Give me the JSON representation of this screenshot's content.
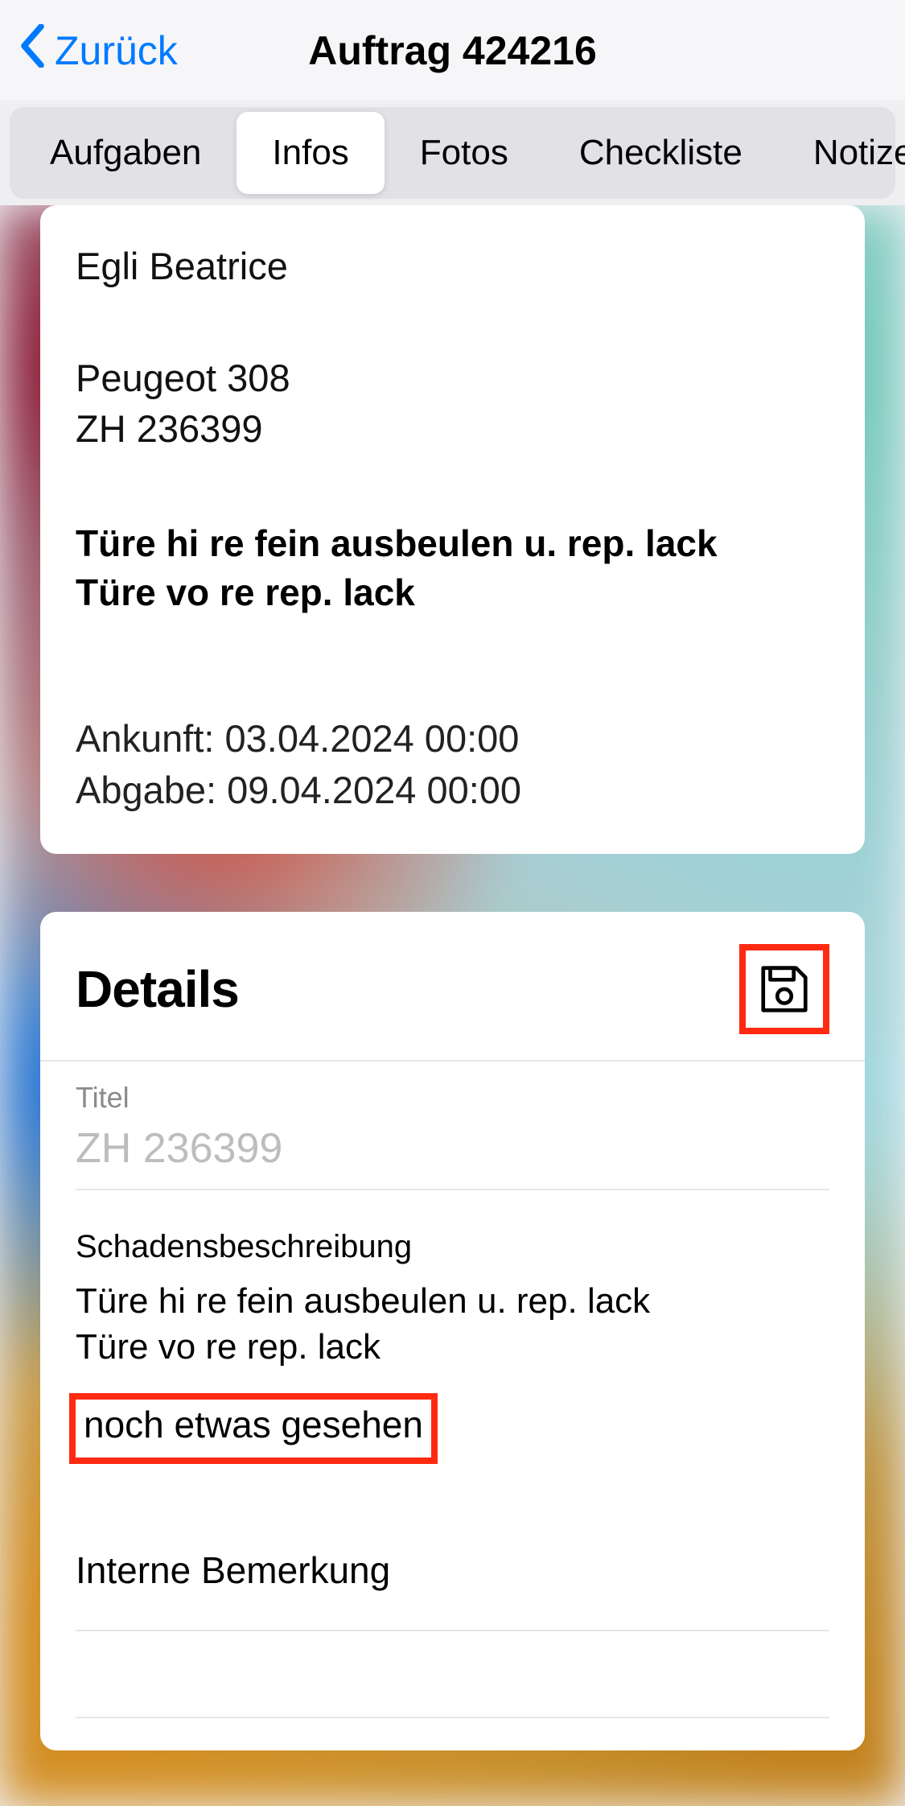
{
  "nav": {
    "back_label": "Zurück",
    "title": "Auftrag 424216"
  },
  "tabs": {
    "items": [
      "Aufgaben",
      "Infos",
      "Fotos",
      "Checkliste",
      "Notize"
    ],
    "active_index": 1
  },
  "summary": {
    "customer_name": "Egli Beatrice",
    "vehicle_model": "Peugeot 308",
    "vehicle_plate": "ZH 236399",
    "work_line1": "Türe hi re fein ausbeulen u. rep. lack",
    "work_line2": "Türe vo re rep. lack",
    "arrival_label": "Ankunft:",
    "arrival_value": "03.04.2024 00:00",
    "delivery_label": "Abgabe:",
    "delivery_value": "09.04.2024 00:00"
  },
  "details": {
    "heading": "Details",
    "title_field": {
      "label": "Titel",
      "value": "ZH 236399"
    },
    "damage": {
      "label": "Schadensbeschreibung",
      "text": "Türe hi re fein ausbeulen u. rep. lack\nTüre vo re rep. lack",
      "added_note": "noch etwas gesehen"
    },
    "internal_remark": {
      "placeholder": "Interne Bemerkung",
      "value": ""
    }
  },
  "highlight_color": "#ff2a12"
}
